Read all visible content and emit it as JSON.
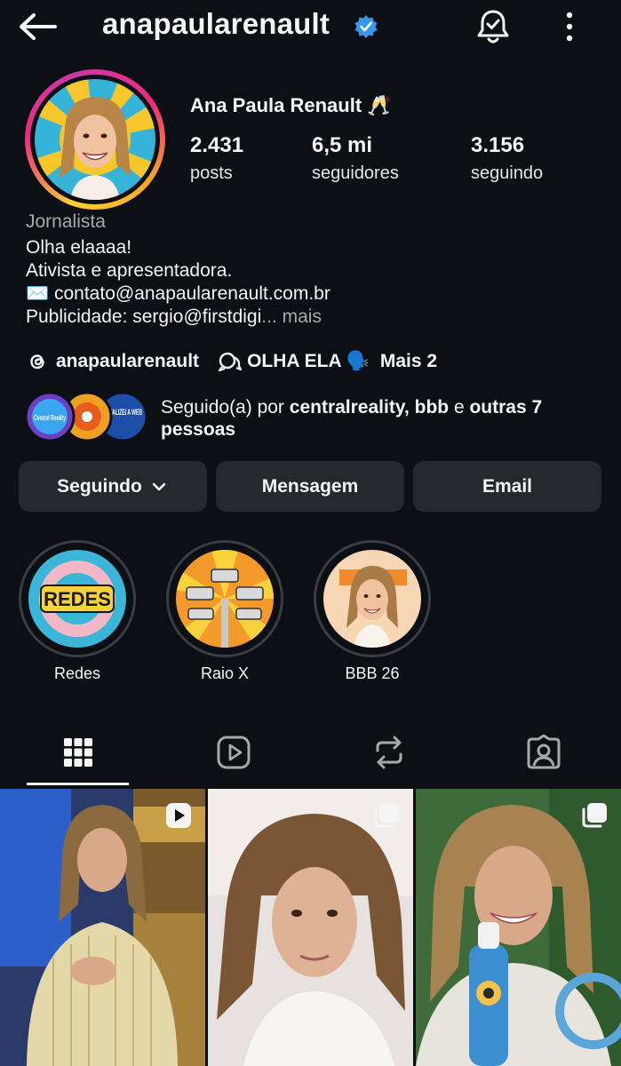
{
  "header": {
    "username": "anapaularenault",
    "back_icon": "arrow-left-icon",
    "verified_icon": "verified-badge-icon",
    "bell_icon": "notification-bell-check-icon",
    "menu_icon": "more-vertical-icon"
  },
  "profile": {
    "full_name": "Ana Paula Renault 🥂",
    "stats": [
      {
        "value": "2.431",
        "label": "posts"
      },
      {
        "value": "6,5 mi",
        "label": "seguidores"
      },
      {
        "value": "3.156",
        "label": "seguindo"
      }
    ],
    "category": "Jornalista",
    "bio_lines": [
      "Olha elaaaa!",
      "Ativista e apresentadora.",
      "✉️ contato@anapaularenault.com.br"
    ],
    "bio_last": "Publicidade: sergio@firstdigi",
    "bio_more": "... mais"
  },
  "links": {
    "threads_icon": "threads-icon",
    "threads_handle": "anapaularenault",
    "link_icon": "chat-link-icon",
    "link_text": "OLHA ELA 🗣️",
    "more_links": "Mais 2"
  },
  "followed_by": {
    "prefix": "Seguido(a) por ",
    "names": "centralreality, bbb",
    "middle": " e ",
    "others": "outras 7 pessoas",
    "avatar_labels": [
      "Central Reality",
      "ATUALIZEI A WEB"
    ]
  },
  "buttons": {
    "following": "Seguindo",
    "message": "Mensagem",
    "email": "Email"
  },
  "highlights": [
    {
      "label": "Redes",
      "text": "REDES"
    },
    {
      "label": "Raio X"
    },
    {
      "label": "BBB 26"
    }
  ],
  "tabs": [
    {
      "name": "grid",
      "icon": "grid-icon",
      "active": true
    },
    {
      "name": "reels",
      "icon": "reels-play-icon",
      "active": false
    },
    {
      "name": "reposts",
      "icon": "repost-icon",
      "active": false
    },
    {
      "name": "tagged",
      "icon": "tagged-person-icon",
      "active": false
    }
  ],
  "posts": [
    {
      "badge": "reel-icon"
    },
    {
      "badge": "carousel-icon"
    },
    {
      "badge": "carousel-icon"
    }
  ],
  "colors": {
    "background": "#0c1014",
    "button_bg": "#25292e",
    "verified": "#3897f0",
    "muted_text": "#a8a8a8"
  }
}
